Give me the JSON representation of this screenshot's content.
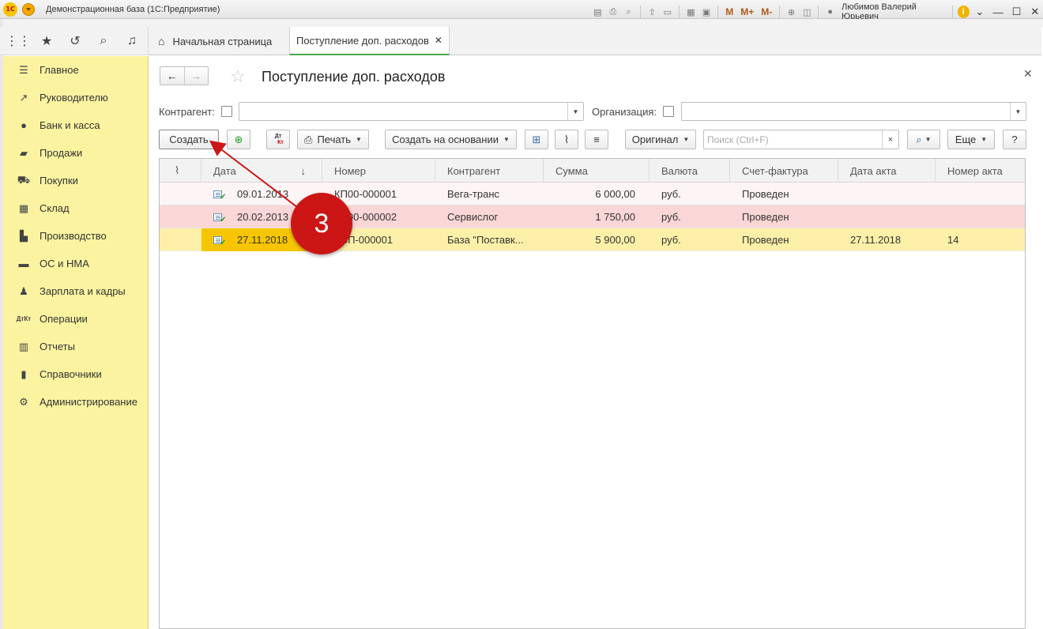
{
  "titlebar": {
    "logo": "1С",
    "title": "Демонстрационная база (1С:Предприятие)",
    "memory_buttons": [
      "M",
      "M+",
      "M-"
    ],
    "user": "Любимов Валерий Юрьевич"
  },
  "tabs": {
    "home": "Начальная страница",
    "active": "Поступление доп. расходов"
  },
  "sidebar": {
    "items": [
      {
        "label": "Главное",
        "icon": "menu-icon"
      },
      {
        "label": "Руководителю",
        "icon": "trend-icon"
      },
      {
        "label": "Банк и касса",
        "icon": "coin-icon"
      },
      {
        "label": "Продажи",
        "icon": "bag-icon"
      },
      {
        "label": "Покупки",
        "icon": "cart-icon"
      },
      {
        "label": "Склад",
        "icon": "warehouse-icon"
      },
      {
        "label": "Производство",
        "icon": "factory-icon"
      },
      {
        "label": "ОС и НМА",
        "icon": "truck-icon"
      },
      {
        "label": "Зарплата и кадры",
        "icon": "person-icon"
      },
      {
        "label": "Операции",
        "icon": "dt-kt-icon"
      },
      {
        "label": "Отчеты",
        "icon": "bar-chart-icon"
      },
      {
        "label": "Справочники",
        "icon": "book-icon"
      },
      {
        "label": "Администрирование",
        "icon": "gear-icon"
      }
    ]
  },
  "page": {
    "title": "Поступление доп. расходов"
  },
  "filters": {
    "counterparty_label": "Контрагент:",
    "organization_label": "Организация:"
  },
  "commands": {
    "create": "Создать",
    "dtkt_top": "Дт",
    "dtkt_bottom": "Кт",
    "print": "Печать",
    "create_based_on": "Создать на основании",
    "original": "Оригинал",
    "search_placeholder": "Поиск (Ctrl+F)",
    "clear": "×",
    "more": "Еще",
    "help": "?"
  },
  "table": {
    "columns": [
      "Дата",
      "Номер",
      "Контрагент",
      "Сумма",
      "Валюта",
      "Счет-фактура",
      "Дата акта",
      "Номер акта"
    ],
    "rows": [
      {
        "date": "09.01.2013",
        "number": "КП00-000001",
        "counterparty": "Вега-транс",
        "sum": "6 000,00",
        "currency": "руб.",
        "invoice": "Проведен",
        "act_date": "",
        "act_number": "",
        "bg": "#fdf5f5"
      },
      {
        "date": "20.02.2013",
        "number": "КП00-000002",
        "counterparty": "Сервислог",
        "sum": "1 750,00",
        "currency": "руб.",
        "invoice": "Проведен",
        "act_date": "",
        "act_number": "",
        "bg": "#fad6d6"
      },
      {
        "date": "27.11.2018",
        "number": "ББП-000001",
        "counterparty": "База \"Поставк...",
        "sum": "5 900,00",
        "currency": "руб.",
        "invoice": "Проведен",
        "act_date": "27.11.2018",
        "act_number": "14",
        "bg": "#fcf0a8",
        "selected": true
      }
    ]
  },
  "annotation": {
    "step": "3",
    "color": "#cc1515"
  }
}
